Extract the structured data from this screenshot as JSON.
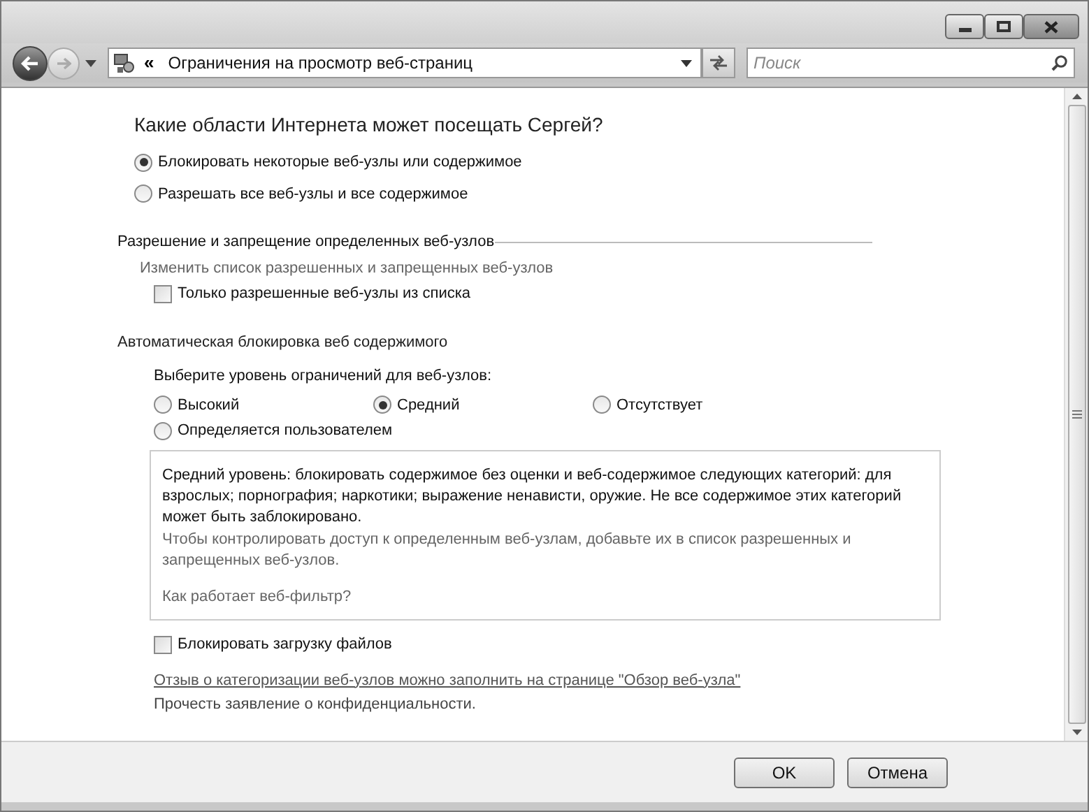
{
  "address_bar": {
    "chevron": "«",
    "path": "Ограничения на просмотр веб-страниц"
  },
  "search": {
    "placeholder": "Поиск"
  },
  "heading": "Какие области Интернета может посещать Сергей?",
  "mode_options": [
    {
      "label": "Блокировать некоторые веб-узлы или содержимое",
      "selected": true
    },
    {
      "label": "Разрешать все веб-узлы и все содержимое",
      "selected": false
    }
  ],
  "allow_block_section": {
    "title": "Разрешение и запрещение определенных веб-узлов",
    "link": "Изменить список разрешенных и  запрещенных веб-узлов",
    "checkbox": {
      "label": "Только разрешенные веб-узлы из списка",
      "checked": false
    }
  },
  "auto_block_section": {
    "title": "Автоматическая блокировка веб  содержимого",
    "prompt": "Выберите уровень ограничений для веб-узлов:",
    "levels": [
      {
        "label": "Высокий",
        "selected": false
      },
      {
        "label": "Средний",
        "selected": true
      },
      {
        "label": "Отсутствует",
        "selected": false
      },
      {
        "label": "Определяется пользователем",
        "selected": false
      }
    ],
    "description": "Средний уровень: блокировать содержимое без оценки и веб-содержимое следующих категорий: для взрослых; порнография; наркотики; выражение ненависти, оружие. Не все содержимое этих категорий может быть заблокировано.",
    "hint": "Чтобы контролировать доступ к определенным веб-узлам, добавьте их в список разрешенных и запрещенных веб-узлов.",
    "help_link": "Как работает веб-фильтр?"
  },
  "download_checkbox": {
    "label": "Блокировать загрузку файлов",
    "checked": false
  },
  "feedback_link": "Отзыв о категоризации веб-узлов можно заполнить на странице \"Обзор веб-узла\"",
  "privacy_link": "Прочесть заявление о конфиденциальности.",
  "buttons": [
    "OK",
    "Отмена"
  ]
}
